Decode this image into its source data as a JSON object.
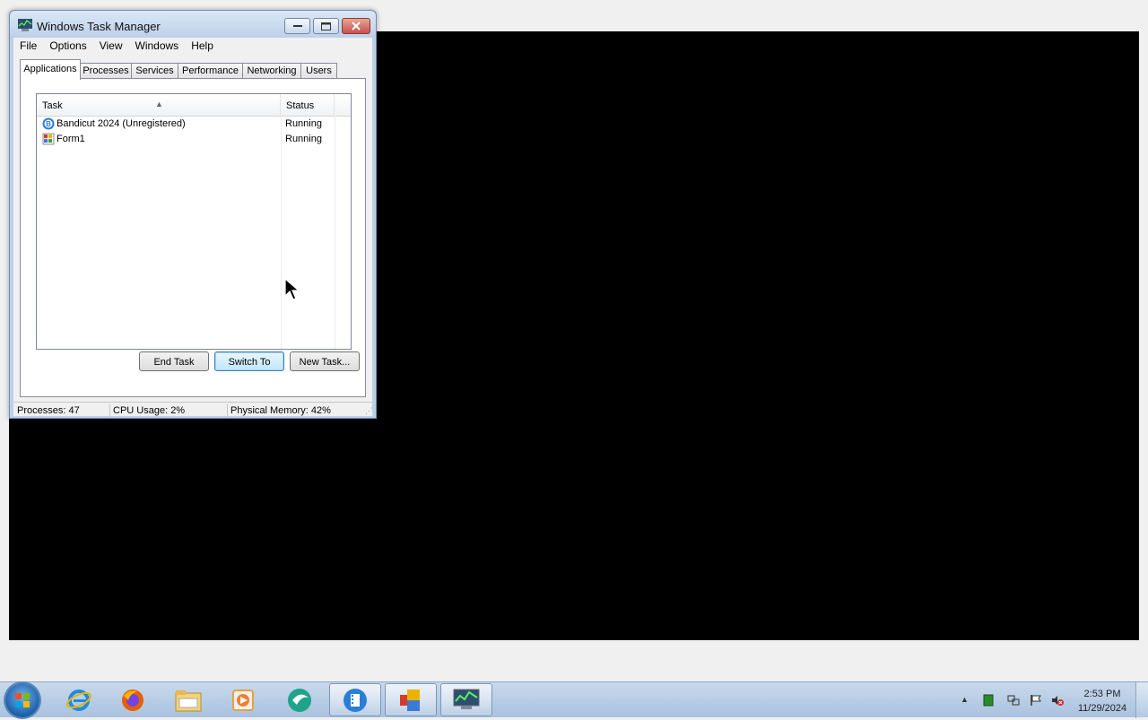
{
  "window": {
    "title": "Windows Task Manager",
    "menu": [
      "File",
      "Options",
      "View",
      "Windows",
      "Help"
    ],
    "tabs": [
      "Applications",
      "Processes",
      "Services",
      "Performance",
      "Networking",
      "Users"
    ],
    "active_tab": "Applications",
    "list": {
      "columns": [
        "Task",
        "Status"
      ],
      "rows": [
        {
          "task": "Bandicut 2024 (Unregistered)",
          "status": "Running",
          "icon": "bandicut-icon"
        },
        {
          "task": "Form1",
          "status": "Running",
          "icon": "form-app-icon"
        }
      ]
    },
    "buttons": {
      "end_task": "End Task",
      "switch_to": "Switch To",
      "new_task": "New Task..."
    },
    "status": {
      "processes": "Processes: 47",
      "cpu": "CPU Usage: 2%",
      "memory": "Physical Memory: 42%"
    }
  },
  "taskbar": {
    "items": [
      "start-orb",
      "internet-explorer-icon",
      "firefox-icon",
      "file-explorer-icon",
      "media-player-icon",
      "app-icon",
      "bandicut-taskbar-icon",
      "form-app-taskbar-icon",
      "task-manager-taskbar-icon"
    ],
    "clock_time": "2:53 PM",
    "clock_date": "11/29/2024"
  },
  "colors": {
    "desktop_black": "#000000",
    "taskbar": "#b9cee6",
    "window_frame": "#bcd0e8"
  }
}
